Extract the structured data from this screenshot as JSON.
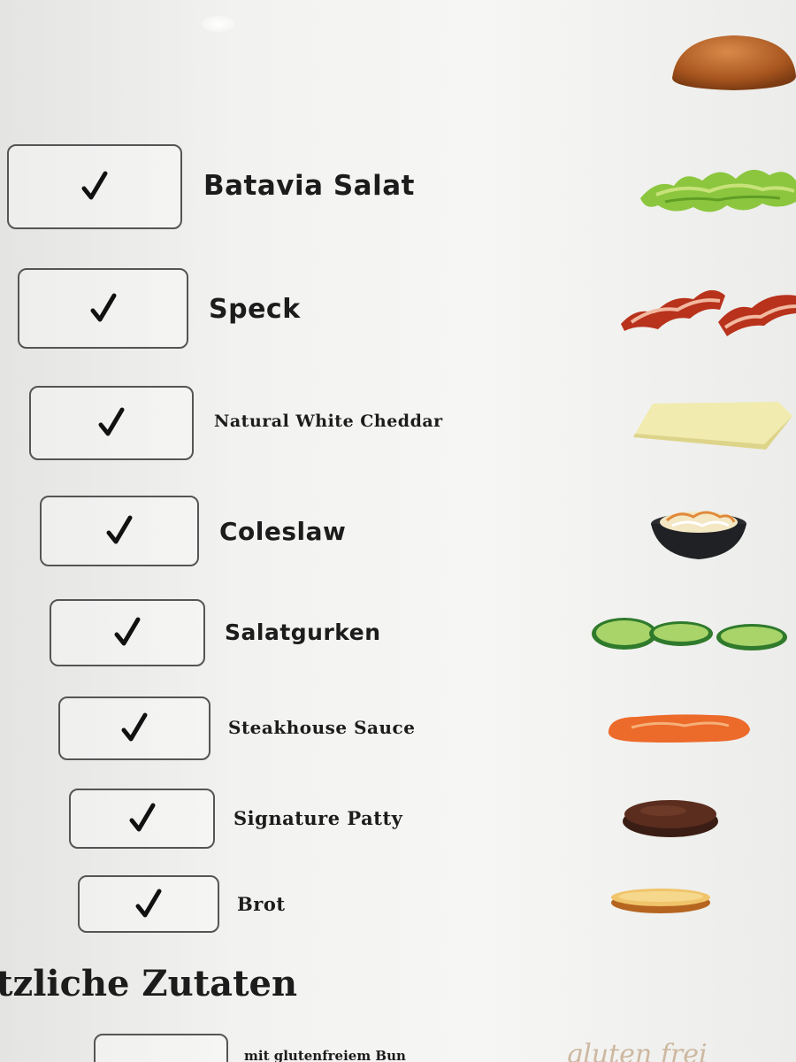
{
  "ingredients": [
    {
      "name": "Batavia Salat",
      "checked": true,
      "image": "lettuce-leaf"
    },
    {
      "name": "Speck",
      "checked": true,
      "image": "bacon-strips"
    },
    {
      "name": "Natural White Cheddar",
      "checked": true,
      "image": "cheese-slice"
    },
    {
      "name": "Coleslaw",
      "checked": true,
      "image": "coleslaw-bowl"
    },
    {
      "name": "Salatgurken",
      "checked": true,
      "image": "cucumber-slices"
    },
    {
      "name": "Steakhouse Sauce",
      "checked": true,
      "image": "sauce-smear"
    },
    {
      "name": "Signature Patty",
      "checked": true,
      "image": "beef-patty"
    },
    {
      "name": "Brot",
      "checked": true,
      "image": "bottom-bun"
    }
  ],
  "top_image": "top-bun",
  "section": {
    "title": "tzliche Zutaten"
  },
  "extra_option": {
    "label": "mit glutenfreiem Bun",
    "logo_text": "gluten frei",
    "checked": false
  },
  "icons": {
    "check": "checkmark-icon"
  }
}
